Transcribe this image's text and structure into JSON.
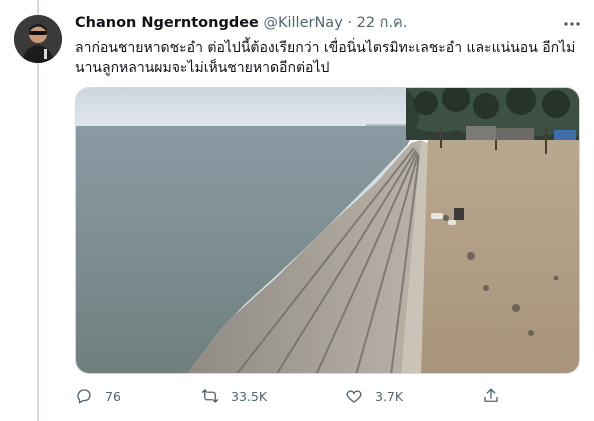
{
  "tweet": {
    "display_name": "Chanon Ngerntongdee",
    "handle": "@KillerNay",
    "separator": "·",
    "timestamp": "22 ก.ค.",
    "text": "ลาก่อนชายหาดชะอำ ต่อไปนี้ต้องเรียกว่า เขื่อนิ่นไตรมิทะเลชะอำ และแน่นอน อีกไม่\nนานลูกหลานผมจะไม่เห็นชายหาดอีกต่อไป",
    "media": {
      "alt_description": "Beach with concrete seawall steps"
    }
  },
  "actions": {
    "reply": {
      "icon": "reply-icon",
      "count": "76"
    },
    "retweet": {
      "icon": "retweet-icon",
      "count": "33.5K"
    },
    "like": {
      "icon": "heart-icon",
      "count": "3.7K"
    },
    "share": {
      "icon": "share-icon"
    }
  },
  "colors": {
    "text_primary": "#0f1419",
    "text_secondary": "#536471",
    "border": "#cfd9de"
  }
}
